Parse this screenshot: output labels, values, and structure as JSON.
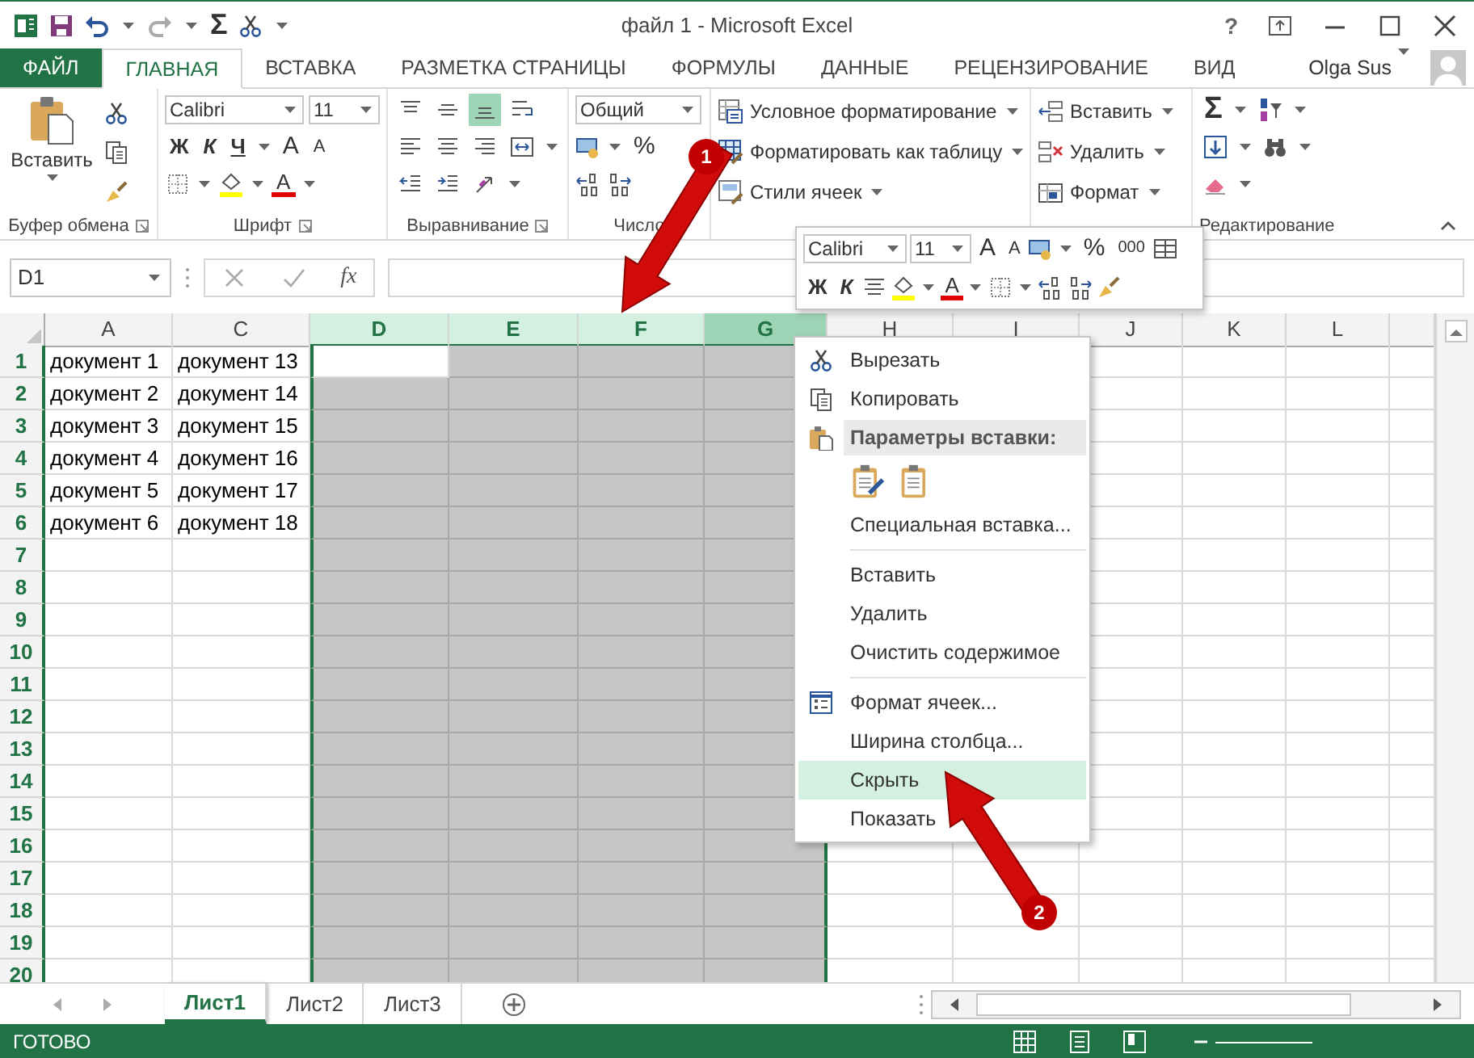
{
  "window": {
    "title": "файл 1 - Microsoft Excel",
    "help": "?"
  },
  "quick_access": {
    "autosum": "Σ"
  },
  "ribbon_tabs": [
    {
      "label": "ФАЙЛ",
      "kind": "file",
      "selected": false
    },
    {
      "label": "ГЛАВНАЯ",
      "kind": "tab",
      "selected": true
    },
    {
      "label": "ВСТАВКА",
      "kind": "tab",
      "selected": false
    },
    {
      "label": "РАЗМЕТКА СТРАНИЦЫ",
      "kind": "tab",
      "selected": false
    },
    {
      "label": "ФОРМУЛЫ",
      "kind": "tab",
      "selected": false
    },
    {
      "label": "ДАННЫЕ",
      "kind": "tab",
      "selected": false
    },
    {
      "label": "РЕЦЕНЗИРОВАНИЕ",
      "kind": "tab",
      "selected": false
    },
    {
      "label": "ВИД",
      "kind": "tab",
      "selected": false
    }
  ],
  "user": {
    "name": "Olga Sus"
  },
  "ribbon": {
    "clipboard": {
      "paste": "Вставить",
      "label": "Буфер обмена"
    },
    "font": {
      "name": "Calibri",
      "size": "11",
      "bold": "Ж",
      "italic": "К",
      "underline": "Ч",
      "grow": "A",
      "shrink": "A",
      "font_color": "A",
      "label": "Шрифт"
    },
    "alignment": {
      "bottom_selected": true,
      "label": "Выравнивание"
    },
    "number": {
      "format": "Общий",
      "percent": "%",
      "label": "Число"
    },
    "styles": {
      "items": [
        "Условное форматирование",
        "Форматировать как таблицу",
        "Стили ячеек"
      ]
    },
    "cells": {
      "items": [
        "Вставить",
        "Удалить",
        "Формат"
      ]
    },
    "editing": {
      "autosum": "Σ",
      "label": "Редактирование"
    }
  },
  "formula_bar": {
    "name_box": "D1",
    "function_label": "fx"
  },
  "grid": {
    "columns": [
      {
        "letter": "A",
        "selected": false,
        "hovered": false
      },
      {
        "letter": "C",
        "selected": false,
        "hovered": false
      },
      {
        "letter": "D",
        "selected": true,
        "hovered": false
      },
      {
        "letter": "E",
        "selected": true,
        "hovered": false
      },
      {
        "letter": "F",
        "selected": true,
        "hovered": false
      },
      {
        "letter": "G",
        "selected": true,
        "hovered": true
      },
      {
        "letter": "H",
        "selected": false,
        "hovered": false
      },
      {
        "letter": "I",
        "selected": false,
        "hovered": false
      },
      {
        "letter": "J",
        "selected": false,
        "hovered": false
      },
      {
        "letter": "K",
        "selected": false,
        "hovered": false
      },
      {
        "letter": "L",
        "selected": false,
        "hovered": false
      }
    ],
    "rows": [
      {
        "number": "1",
        "selected": true,
        "active": true,
        "cells": [
          "документ 1",
          "документ 13"
        ]
      },
      {
        "number": "2",
        "selected": true,
        "active": false,
        "cells": [
          "документ 2",
          "документ 14"
        ]
      },
      {
        "number": "3",
        "selected": true,
        "active": false,
        "cells": [
          "документ 3",
          "документ 15"
        ]
      },
      {
        "number": "4",
        "selected": true,
        "active": false,
        "cells": [
          "документ 4",
          "документ 16"
        ]
      },
      {
        "number": "5",
        "selected": true,
        "active": false,
        "cells": [
          "документ 5",
          "документ 17"
        ]
      },
      {
        "number": "6",
        "selected": true,
        "active": false,
        "cells": [
          "документ 6",
          "документ 18"
        ]
      },
      {
        "number": "7",
        "selected": true,
        "active": false
      },
      {
        "number": "8",
        "selected": true,
        "active": false
      },
      {
        "number": "9",
        "selected": true,
        "active": false
      },
      {
        "number": "10",
        "selected": true,
        "active": false
      },
      {
        "number": "11",
        "selected": true,
        "active": false
      },
      {
        "number": "12",
        "selected": true,
        "active": false
      },
      {
        "number": "13",
        "selected": true,
        "active": false
      },
      {
        "number": "14",
        "selected": true,
        "active": false
      },
      {
        "number": "15",
        "selected": true,
        "active": false
      },
      {
        "number": "16",
        "selected": true,
        "active": false
      },
      {
        "number": "17",
        "selected": true,
        "active": false
      },
      {
        "number": "18",
        "selected": true,
        "active": false
      },
      {
        "number": "19",
        "selected": true,
        "active": false
      },
      {
        "number": "20",
        "selected": true,
        "active": false
      }
    ]
  },
  "mini_toolbar": {
    "font": "Calibri",
    "size": "11",
    "grow": "A",
    "shrink": "A",
    "percent": "%",
    "thousands": "000",
    "bold": "Ж",
    "italic": "К",
    "font_color": "A"
  },
  "context_menu": {
    "items": [
      {
        "label": "Вырезать",
        "kind": "cut",
        "selected": false
      },
      {
        "label": "Копировать",
        "kind": "copy",
        "selected": false
      },
      {
        "label": "Параметры вставки:",
        "kind": "paste_header"
      },
      {
        "kind": "paste_options"
      },
      {
        "label": "Специальная вставка...",
        "kind": "item",
        "selected": false
      },
      {
        "kind": "separator"
      },
      {
        "label": "Вставить",
        "kind": "item",
        "selected": false
      },
      {
        "label": "Удалить",
        "kind": "item",
        "selected": false
      },
      {
        "label": "Очистить содержимое",
        "kind": "item",
        "selected": false
      },
      {
        "kind": "separator"
      },
      {
        "label": "Формат ячеек...",
        "kind": "format",
        "selected": false
      },
      {
        "label": "Ширина столбца...",
        "kind": "item",
        "selected": false
      },
      {
        "label": "Скрыть",
        "kind": "item",
        "selected": true
      },
      {
        "label": "Показать",
        "kind": "item",
        "selected": false
      }
    ]
  },
  "sheet_tabs": [
    {
      "label": "Лист1",
      "selected": true
    },
    {
      "label": "Лист2",
      "selected": false
    },
    {
      "label": "Лист3",
      "selected": false
    }
  ],
  "status_bar": {
    "text": "ГОТОВО"
  },
  "annotations": [
    {
      "number": "1"
    },
    {
      "number": "2"
    }
  ]
}
